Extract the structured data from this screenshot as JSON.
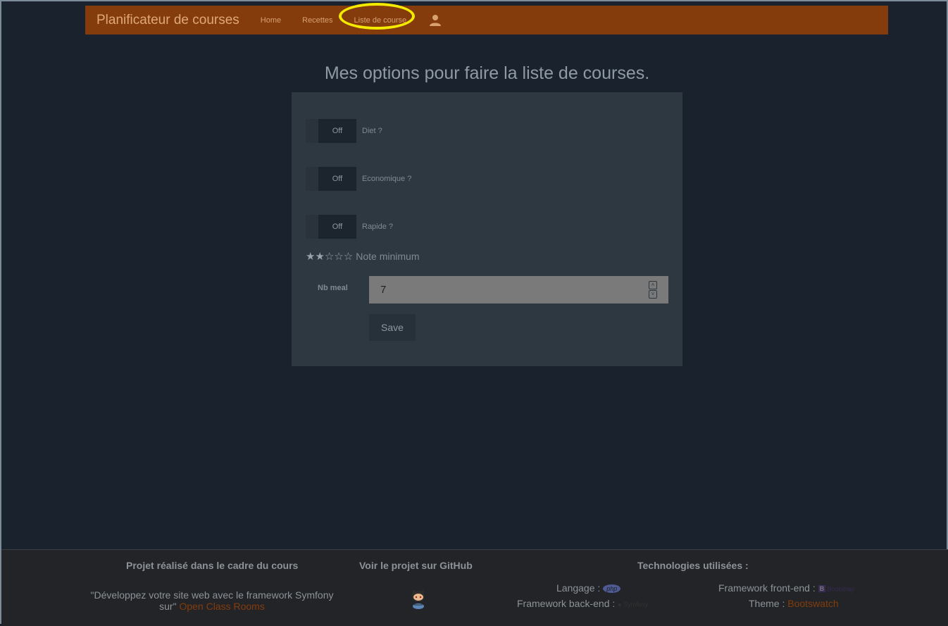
{
  "navbar": {
    "brand": "Planificateur de courses",
    "links": [
      "Home",
      "Recettes",
      "Liste de course"
    ]
  },
  "page": {
    "heading": "Mes options pour faire la liste de courses."
  },
  "options": [
    {
      "state": "Off",
      "label": "Diet ?"
    },
    {
      "state": "Off",
      "label": "Economique ?"
    },
    {
      "state": "Off",
      "label": "Rapide ?"
    }
  ],
  "rating": {
    "stars": "★★☆☆☆",
    "value": 2,
    "max": 5,
    "label": "Note minimum"
  },
  "nb_meal": {
    "label": "Nb meal",
    "value": "7"
  },
  "save_label": "Save",
  "footer": {
    "col1_title": "Projet réalisé dans le cadre du cours",
    "col1_line1": "\"Développez votre site web avec le framework Symfony",
    "col1_line2_prefix": "sur\" ",
    "col1_link": "Open Class Rooms",
    "col2_title": "Voir le projet sur GitHub",
    "col3_title": "Technologies utilisées :",
    "lang_label": "Langage :",
    "lang_logo": "php",
    "backend_label": "Framework back-end :",
    "backend_logo": "Symfony",
    "frontend_label": "Framework front-end :",
    "frontend_logo": "Bootstrap",
    "theme_label": "Theme :",
    "theme_link": "Bootswatch"
  },
  "colors": {
    "navbar": "#843c0d",
    "background": "#1a232d",
    "panel": "#2e3841",
    "highlight": "#f4ea00"
  }
}
